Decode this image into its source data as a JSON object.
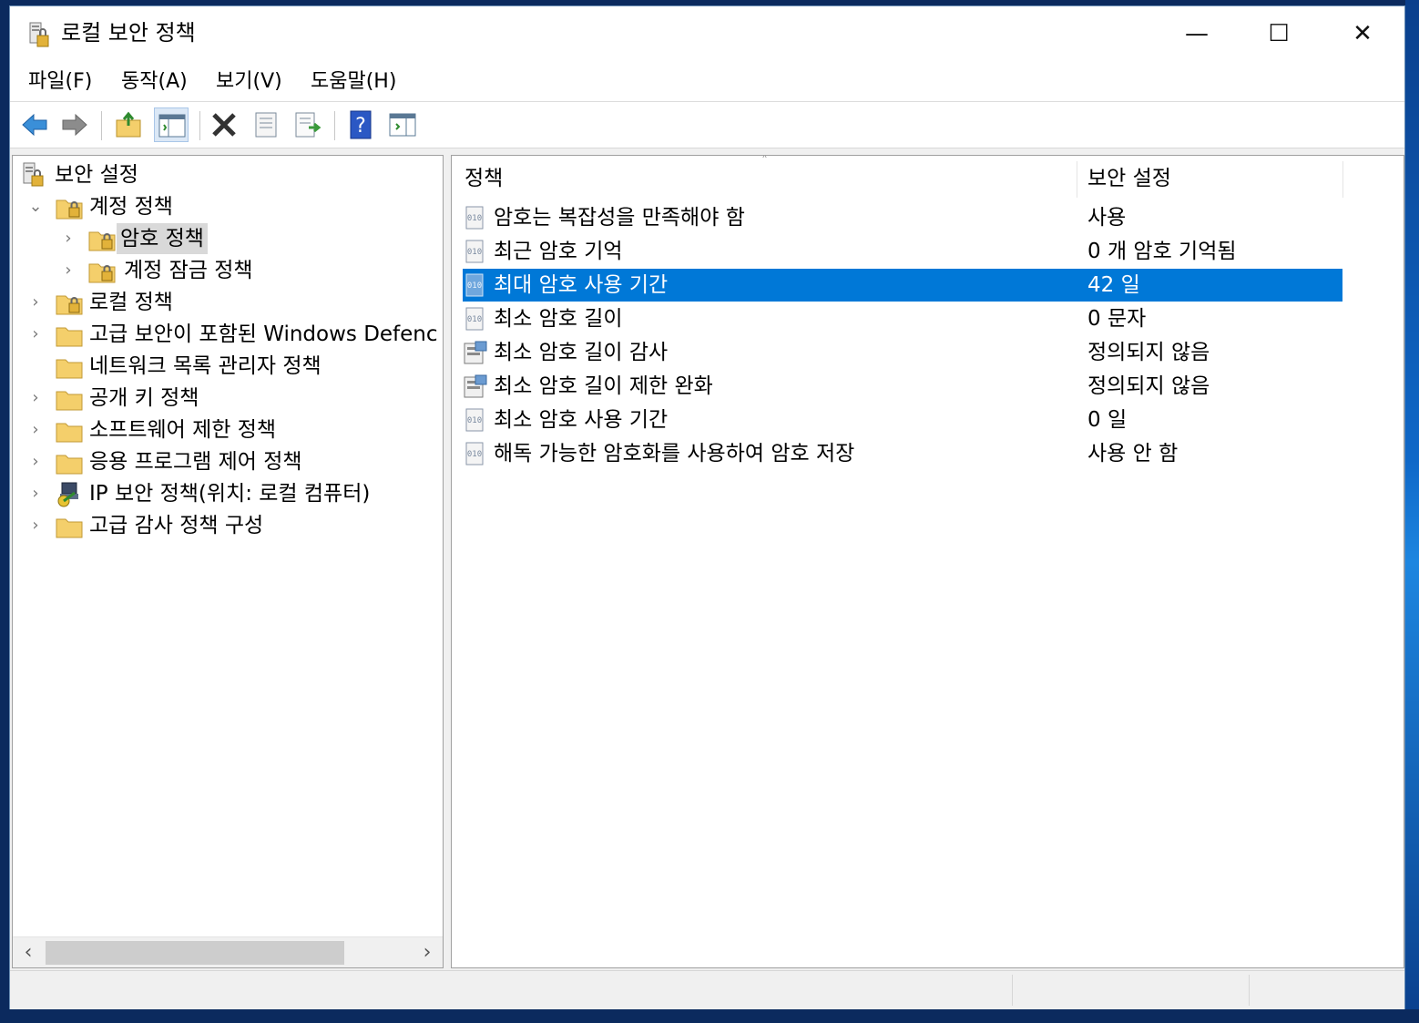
{
  "window": {
    "title": "로컬 보안 정책",
    "minimize_glyph": "—",
    "maximize_glyph": "☐",
    "close_glyph": "✕"
  },
  "menu": [
    {
      "label": "파일(F)"
    },
    {
      "label": "동작(A)"
    },
    {
      "label": "보기(V)"
    },
    {
      "label": "도움말(H)"
    }
  ],
  "toolbar": {
    "icons": [
      "back-arrow-icon",
      "forward-arrow-icon",
      "up-folder-icon",
      "show-hide-tree-icon",
      "delete-icon",
      "properties-icon",
      "export-list-icon",
      "help-icon",
      "show-action-pane-icon"
    ]
  },
  "tree": {
    "items": [
      {
        "label": "보안 설정",
        "icon": "security-settings-icon"
      },
      {
        "label": "계정 정책",
        "icon": "policy-folder-icon",
        "expander": "⌄"
      },
      {
        "label": "암호 정책",
        "icon": "policy-folder-icon",
        "expander": "›",
        "selected": true
      },
      {
        "label": "계정 잠금 정책",
        "icon": "policy-folder-icon",
        "expander": "›"
      },
      {
        "label": "로컬 정책",
        "icon": "policy-folder-icon",
        "expander": "›"
      },
      {
        "label": "고급 보안이 포함된 Windows Defenc",
        "icon": "folder-icon",
        "expander": "›"
      },
      {
        "label": "네트워크 목록 관리자 정책",
        "icon": "folder-icon"
      },
      {
        "label": "공개 키 정책",
        "icon": "folder-icon",
        "expander": "›"
      },
      {
        "label": "소프트웨어 제한 정책",
        "icon": "folder-icon",
        "expander": "›"
      },
      {
        "label": "응용 프로그램 제어 정책",
        "icon": "folder-icon",
        "expander": "›"
      },
      {
        "label": "IP 보안 정책(위치: 로컬 컴퓨터)",
        "icon": "ip-security-icon",
        "expander": "›"
      },
      {
        "label": "고급 감사 정책 구성",
        "icon": "folder-icon",
        "expander": "›"
      }
    ],
    "scroll_left": "‹",
    "scroll_right": "›"
  },
  "list": {
    "headers": {
      "policy": "정책",
      "setting": "보안 설정"
    },
    "sort_indicator": "˄",
    "rows": [
      {
        "policy": "암호는 복잡성을 만족해야 함",
        "setting": "사용",
        "icon": "policy-setting-icon"
      },
      {
        "policy": "최근 암호 기억",
        "setting": "0 개 암호 기억됨",
        "icon": "policy-setting-icon"
      },
      {
        "policy": "최대 암호 사용 기간",
        "setting": "42 일",
        "icon": "policy-setting-icon",
        "selected": true
      },
      {
        "policy": "최소 암호 길이",
        "setting": "0 문자",
        "icon": "policy-setting-icon"
      },
      {
        "policy": "최소 암호 길이 감사",
        "setting": "정의되지 않음",
        "icon": "policy-audit-icon"
      },
      {
        "policy": "최소 암호 길이 제한 완화",
        "setting": "정의되지 않음",
        "icon": "policy-audit-icon"
      },
      {
        "policy": "최소 암호 사용 기간",
        "setting": "0 일",
        "icon": "policy-setting-icon"
      },
      {
        "policy": "해독 가능한 암호화를 사용하여 암호 저장",
        "setting": "사용 안 함",
        "icon": "policy-setting-icon"
      }
    ]
  },
  "colors": {
    "selection": "#0078d7",
    "tree_selection": "#d9d9d9",
    "folder": "#f4cf6b"
  }
}
